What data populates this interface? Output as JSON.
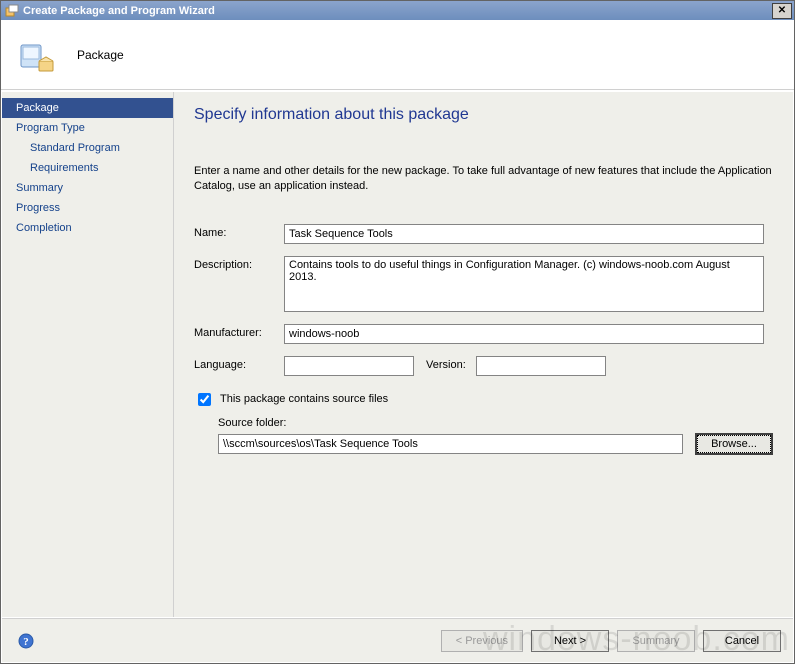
{
  "window": {
    "title": "Create Package and Program Wizard"
  },
  "header": {
    "subtitle": "Package"
  },
  "sidebar": {
    "items": [
      {
        "label": "Package",
        "active": true,
        "indent": false
      },
      {
        "label": "Program Type",
        "active": false,
        "indent": false
      },
      {
        "label": "Standard Program",
        "active": false,
        "indent": true
      },
      {
        "label": "Requirements",
        "active": false,
        "indent": true
      },
      {
        "label": "Summary",
        "active": false,
        "indent": false
      },
      {
        "label": "Progress",
        "active": false,
        "indent": false
      },
      {
        "label": "Completion",
        "active": false,
        "indent": false
      }
    ]
  },
  "page": {
    "title": "Specify information about this package",
    "intro": "Enter a name and other details for the new package. To take full advantage of new features that include the Application Catalog, use an application instead.",
    "labels": {
      "name": "Name:",
      "description": "Description:",
      "manufacturer": "Manufacturer:",
      "language": "Language:",
      "version": "Version:",
      "source_checkbox": "This package contains source files",
      "source_folder": "Source folder:"
    },
    "values": {
      "name": "Task Sequence Tools",
      "description": "Contains tools to do useful things in Configuration Manager. (c) windows-noob.com August 2013.",
      "manufacturer": "windows-noob",
      "language": "",
      "version": "",
      "source_checked": true,
      "source_folder": "\\\\sccm\\sources\\os\\Task Sequence Tools"
    },
    "buttons": {
      "browse": "Browse..."
    }
  },
  "footer": {
    "previous": "< Previous",
    "next": "Next >",
    "summary": "Summary",
    "cancel": "Cancel"
  },
  "watermark": "windows-noob.com"
}
